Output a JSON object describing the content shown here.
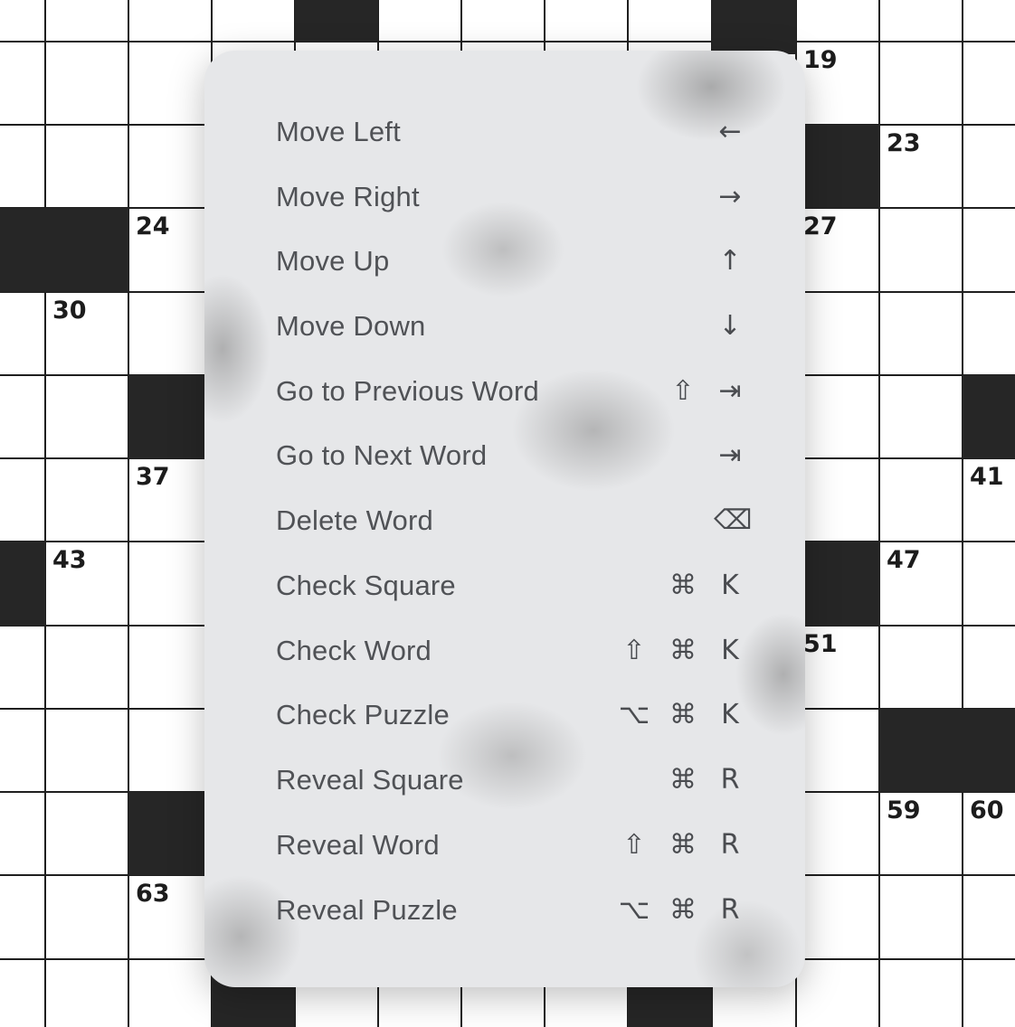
{
  "crossword": {
    "clue_numbers": [
      "19",
      "23",
      "24",
      "27",
      "30",
      "37",
      "41",
      "43",
      "47",
      "51",
      "59",
      "60",
      "63"
    ]
  },
  "shortcuts_menu": {
    "items": [
      {
        "label": "Move Left",
        "keys": [
          "",
          "",
          "←"
        ]
      },
      {
        "label": "Move Right",
        "keys": [
          "",
          "",
          "→"
        ]
      },
      {
        "label": "Move Up",
        "keys": [
          "",
          "",
          "↑"
        ]
      },
      {
        "label": "Move Down",
        "keys": [
          "",
          "",
          "↓"
        ]
      },
      {
        "label": "Go to Previous Word",
        "keys": [
          "",
          "⇧",
          "⇥"
        ]
      },
      {
        "label": "Go to Next Word",
        "keys": [
          "",
          "",
          "⇥"
        ]
      },
      {
        "label": "Delete Word",
        "keys": [
          "",
          "",
          "⌫"
        ]
      },
      {
        "label": "Check Square",
        "keys": [
          "",
          "⌘",
          "K"
        ]
      },
      {
        "label": "Check Word",
        "keys": [
          "⇧",
          "⌘",
          "K"
        ]
      },
      {
        "label": "Check Puzzle",
        "keys": [
          "⌥",
          "⌘",
          "K"
        ]
      },
      {
        "label": "Reveal Square",
        "keys": [
          "",
          "⌘",
          "R"
        ]
      },
      {
        "label": "Reveal Word",
        "keys": [
          "⇧",
          "⌘",
          "R"
        ]
      },
      {
        "label": "Reveal Puzzle",
        "keys": [
          "⌥",
          "⌘",
          "R"
        ]
      }
    ]
  }
}
